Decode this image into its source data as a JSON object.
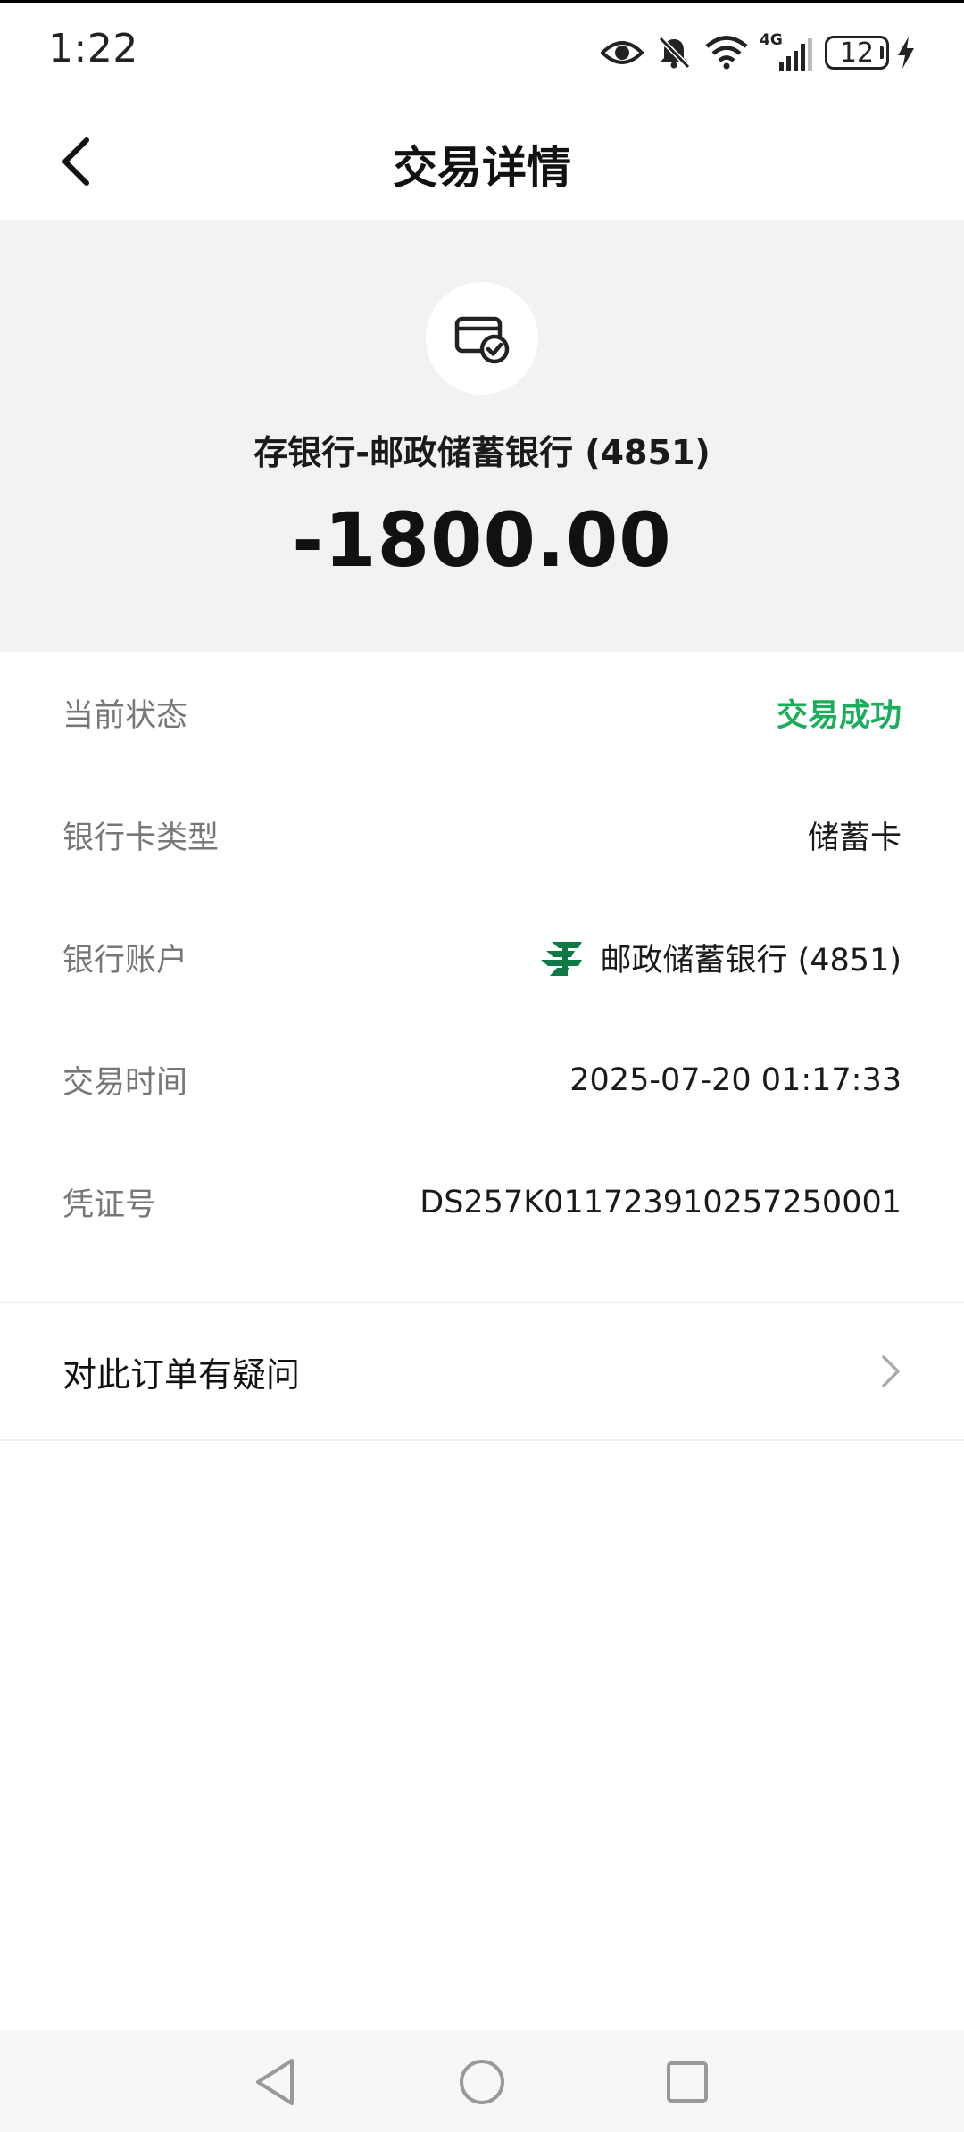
{
  "status_bar": {
    "time": "1:22",
    "network": "4G",
    "battery": "12"
  },
  "header": {
    "title": "交易详情",
    "back_icon": "chevron-left-icon"
  },
  "summary": {
    "icon": "card-check-icon",
    "title": "存银行-邮政储蓄银行 (4851)",
    "amount": "-1800.00"
  },
  "details": {
    "status_label": "当前状态",
    "status_value": "交易成功",
    "status_color": "#1aad5b",
    "card_type_label": "银行卡类型",
    "card_type_value": "储蓄卡",
    "account_label": "银行账户",
    "account_value": "邮政储蓄银行 (4851)",
    "account_icon": "postal-bank-logo-icon",
    "time_label": "交易时间",
    "time_value": "2025-07-20 01:17:33",
    "voucher_label": "凭证号",
    "voucher_value": "DS257K011723910257250001"
  },
  "question": {
    "label": "对此订单有疑问",
    "icon": "chevron-right-icon"
  },
  "system_nav": {
    "back": "triangle-back-icon",
    "home": "circle-home-icon",
    "recents": "square-recents-icon"
  }
}
